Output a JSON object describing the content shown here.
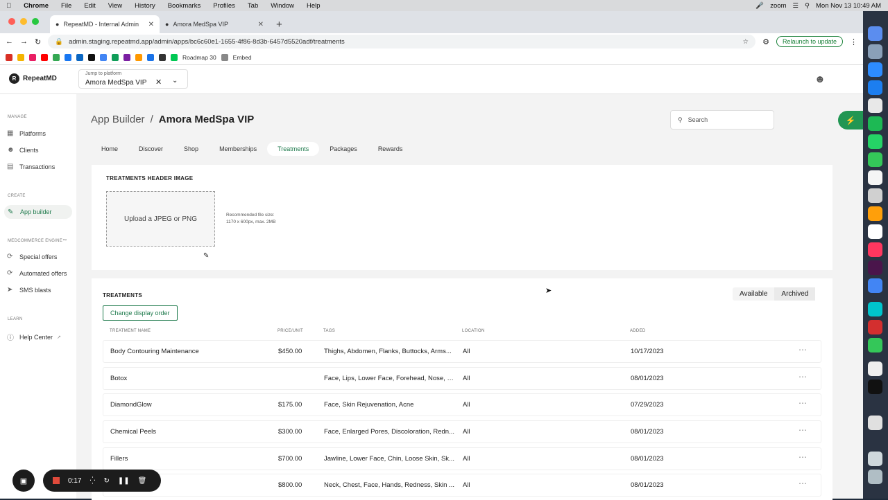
{
  "macbar": {
    "items": [
      "Chrome",
      "File",
      "Edit",
      "View",
      "History",
      "Bookmarks",
      "Profiles",
      "Tab",
      "Window",
      "Help"
    ],
    "zoom": "zoom",
    "datetime": "Mon Nov 13  10:49 AM"
  },
  "browser": {
    "tabs": [
      {
        "title": "RepeatMD - Internal Admin"
      },
      {
        "title": "Amora MedSpa VIP"
      }
    ],
    "url": "admin.staging.repeatmd.app/admin/apps/bc6c60e1-1655-4f86-8d3b-6457d5520adf/treatments",
    "relaunch": "Relaunch to update",
    "bookmarks": [
      "Roadmap 30",
      "Embed"
    ]
  },
  "header": {
    "logo": "RepeatMD",
    "jump_label": "Jump to platform",
    "jump_value": "Amora MedSpa VIP"
  },
  "sidebar": {
    "sections": [
      {
        "title": "MANAGE",
        "items": [
          "Platforms",
          "Clients",
          "Transactions"
        ]
      },
      {
        "title": "CREATE",
        "items": [
          "App builder"
        ]
      },
      {
        "title": "MEDCOMMERCE ENGINE™",
        "items": [
          "Special offers",
          "Automated offers",
          "SMS blasts"
        ]
      },
      {
        "title": "LEARN",
        "items": [
          "Help Center"
        ]
      }
    ]
  },
  "breadcrumb": {
    "root": "App Builder",
    "sep": "/",
    "current": "Amora MedSpa VIP"
  },
  "search": {
    "placeholder": "Search"
  },
  "tabs": [
    "Home",
    "Discover",
    "Shop",
    "Memberships",
    "Treatments",
    "Packages",
    "Rewards"
  ],
  "header_image": {
    "title": "TREATMENTS HEADER IMAGE",
    "upload": "Upload a JPEG or PNG",
    "rec1": "Recommended file size:",
    "rec2": "1170 x 600px, max. 2MB"
  },
  "treatments": {
    "title": "TREATMENTS",
    "toggle": [
      "Available",
      "Archived"
    ],
    "change_order": "Change display order",
    "columns": [
      "TREATMENT NAME",
      "PRICE/UNIT",
      "TAGS",
      "LOCATION",
      "ADDED"
    ],
    "rows": [
      {
        "name": "Body Contouring Maintenance",
        "price": "$450.00",
        "tags": "Thighs, Abdomen, Flanks, Buttocks, Arms...",
        "loc": "All",
        "date": "10/17/2023"
      },
      {
        "name": "Botox",
        "price": "",
        "tags": "Face, Lips, Lower Face, Forehead, Nose, S...",
        "loc": "All",
        "date": "08/01/2023"
      },
      {
        "name": "DiamondGlow",
        "price": "$175.00",
        "tags": "Face, Skin Rejuvenation, Acne",
        "loc": "All",
        "date": "07/29/2023"
      },
      {
        "name": "Chemical Peels",
        "price": "$300.00",
        "tags": "Face, Enlarged Pores, Discoloration, Redn...",
        "loc": "All",
        "date": "08/01/2023"
      },
      {
        "name": "Fillers",
        "price": "$700.00",
        "tags": "Jawline, Lower Face, Chin, Loose Skin, Sk...",
        "loc": "All",
        "date": "08/01/2023"
      },
      {
        "name": "",
        "price": "$800.00",
        "tags": "Neck, Chest, Face, Hands, Redness, Skin ...",
        "loc": "All",
        "date": "08/01/2023"
      }
    ]
  },
  "recorder": {
    "time": "0:17"
  },
  "colors": {
    "accent": "#1e7a4c",
    "fab": "#219653"
  }
}
